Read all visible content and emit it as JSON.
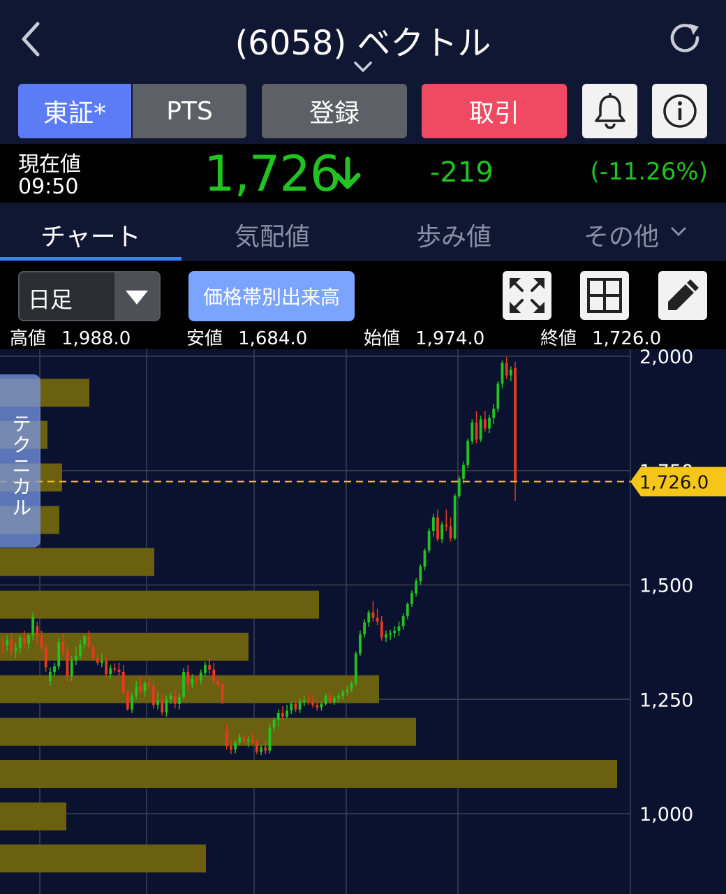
{
  "header": {
    "title": "(6058) ベクトル"
  },
  "market_tabs": {
    "tse_label": "東証*",
    "pts_label": "PTS",
    "register_label": "登録",
    "trade_label": "取引"
  },
  "price": {
    "label": "現在値",
    "time": "09:50",
    "current": "1,726",
    "change": "-219",
    "change_pct": "(-11.26%)",
    "up_color": "#21c321"
  },
  "tabs": {
    "chart": "チャート",
    "quotes": "気配値",
    "ticks": "歩み値",
    "other": "その他"
  },
  "toolbar": {
    "period": "日足",
    "volume_profile": "価格帯別出来高",
    "high_label": "高値",
    "high": "1,988.0",
    "low_label": "安値",
    "low": "1,684.0",
    "open_label": "始値",
    "open": "1,974.0",
    "close_label": "終値",
    "close": "1,726.0"
  },
  "technical_tab": "テクニカル",
  "chart_data": {
    "type": "candlestick",
    "y_ticks": [
      "2,000",
      "1,750",
      "1,500",
      "1,250",
      "1,000"
    ],
    "ylim": [
      880,
      2000
    ],
    "current_price_label": "1,726.0",
    "current_price": 1726,
    "colors": {
      "up": "#21c321",
      "down": "#e8391f",
      "profile": "#6b5f10",
      "price_line": "#f5c518"
    },
    "volume_profile": [
      {
        "price": 1920,
        "length": 128
      },
      {
        "price": 1828,
        "length": 68
      },
      {
        "price": 1735,
        "length": 89
      },
      {
        "price": 1642,
        "length": 85
      },
      {
        "price": 1550,
        "length": 221
      },
      {
        "price": 1457,
        "length": 457
      },
      {
        "price": 1365,
        "length": 356
      },
      {
        "price": 1272,
        "length": 543
      },
      {
        "price": 1179,
        "length": 596
      },
      {
        "price": 1087,
        "length": 884
      },
      {
        "price": 994,
        "length": 95
      },
      {
        "price": 902,
        "length": 295
      }
    ],
    "candles": [
      [
        1370,
        1385,
        1350,
        1368
      ],
      [
        1368,
        1390,
        1355,
        1380
      ],
      [
        1380,
        1395,
        1345,
        1355
      ],
      [
        1355,
        1375,
        1340,
        1362
      ],
      [
        1362,
        1390,
        1350,
        1385
      ],
      [
        1385,
        1400,
        1362,
        1372
      ],
      [
        1372,
        1395,
        1360,
        1390
      ],
      [
        1390,
        1440,
        1380,
        1430
      ],
      [
        1410,
        1420,
        1370,
        1390
      ],
      [
        1390,
        1400,
        1355,
        1362
      ],
      [
        1362,
        1372,
        1310,
        1320
      ],
      [
        1290,
        1320,
        1280,
        1310
      ],
      [
        1310,
        1330,
        1300,
        1322
      ],
      [
        1322,
        1385,
        1315,
        1375
      ],
      [
        1375,
        1395,
        1345,
        1355
      ],
      [
        1355,
        1370,
        1290,
        1300
      ],
      [
        1300,
        1345,
        1290,
        1335
      ],
      [
        1335,
        1365,
        1325,
        1345
      ],
      [
        1345,
        1380,
        1338,
        1370
      ],
      [
        1370,
        1392,
        1360,
        1388
      ],
      [
        1388,
        1400,
        1360,
        1365
      ],
      [
        1365,
        1372,
        1335,
        1340
      ],
      [
        1340,
        1348,
        1325,
        1330
      ],
      [
        1330,
        1350,
        1320,
        1335
      ],
      [
        1335,
        1342,
        1298,
        1305
      ],
      [
        1305,
        1325,
        1295,
        1318
      ],
      [
        1318,
        1328,
        1308,
        1315
      ],
      [
        1315,
        1330,
        1300,
        1310
      ],
      [
        1310,
        1325,
        1260,
        1265
      ],
      [
        1265,
        1270,
        1225,
        1228
      ],
      [
        1228,
        1265,
        1220,
        1258
      ],
      [
        1258,
        1290,
        1250,
        1278
      ],
      [
        1278,
        1298,
        1262,
        1268
      ],
      [
        1268,
        1290,
        1255,
        1285
      ],
      [
        1285,
        1300,
        1270,
        1278
      ],
      [
        1278,
        1292,
        1230,
        1238
      ],
      [
        1238,
        1268,
        1228,
        1248
      ],
      [
        1248,
        1262,
        1215,
        1222
      ],
      [
        1222,
        1258,
        1212,
        1250
      ],
      [
        1250,
        1265,
        1240,
        1258
      ],
      [
        1258,
        1272,
        1230,
        1240
      ],
      [
        1240,
        1262,
        1228,
        1255
      ],
      [
        1255,
        1318,
        1250,
        1310
      ],
      [
        1310,
        1325,
        1270,
        1282
      ],
      [
        1282,
        1305,
        1275,
        1295
      ],
      [
        1295,
        1300,
        1285,
        1292
      ],
      [
        1292,
        1315,
        1282,
        1308
      ],
      [
        1308,
        1332,
        1300,
        1325
      ],
      [
        1325,
        1340,
        1305,
        1315
      ],
      [
        1315,
        1330,
        1280,
        1290
      ],
      [
        1290,
        1298,
        1275,
        1282
      ],
      [
        1282,
        1285,
        1240,
        1248
      ],
      [
        1180,
        1195,
        1140,
        1148
      ],
      [
        1148,
        1160,
        1130,
        1140
      ],
      [
        1140,
        1160,
        1132,
        1155
      ],
      [
        1155,
        1175,
        1150,
        1168
      ],
      [
        1168,
        1172,
        1150,
        1158
      ],
      [
        1158,
        1170,
        1145,
        1162
      ],
      [
        1162,
        1175,
        1152,
        1158
      ],
      [
        1158,
        1162,
        1130,
        1135
      ],
      [
        1135,
        1150,
        1128,
        1145
      ],
      [
        1145,
        1160,
        1130,
        1138
      ],
      [
        1138,
        1195,
        1132,
        1188
      ],
      [
        1188,
        1210,
        1180,
        1205
      ],
      [
        1205,
        1228,
        1190,
        1220
      ],
      [
        1220,
        1235,
        1205,
        1212
      ],
      [
        1212,
        1238,
        1208,
        1225
      ],
      [
        1225,
        1245,
        1218,
        1240
      ],
      [
        1240,
        1248,
        1222,
        1228
      ],
      [
        1228,
        1252,
        1220,
        1245
      ],
      [
        1245,
        1258,
        1235,
        1248
      ],
      [
        1248,
        1262,
        1238,
        1245
      ],
      [
        1245,
        1258,
        1232,
        1238
      ],
      [
        1238,
        1250,
        1225,
        1232
      ],
      [
        1232,
        1245,
        1225,
        1240
      ],
      [
        1240,
        1262,
        1236,
        1258
      ],
      [
        1258,
        1265,
        1240,
        1244
      ],
      [
        1244,
        1258,
        1238,
        1252
      ],
      [
        1252,
        1265,
        1244,
        1258
      ],
      [
        1258,
        1272,
        1250,
        1266
      ],
      [
        1266,
        1280,
        1258,
        1272
      ],
      [
        1272,
        1290,
        1265,
        1285
      ],
      [
        1285,
        1355,
        1280,
        1350
      ],
      [
        1350,
        1400,
        1345,
        1392
      ],
      [
        1392,
        1425,
        1385,
        1418
      ],
      [
        1418,
        1445,
        1408,
        1440
      ],
      [
        1440,
        1465,
        1420,
        1428
      ],
      [
        1428,
        1448,
        1412,
        1420
      ],
      [
        1420,
        1432,
        1378,
        1385
      ],
      [
        1385,
        1400,
        1375,
        1392
      ],
      [
        1392,
        1402,
        1380,
        1395
      ],
      [
        1395,
        1410,
        1385,
        1400
      ],
      [
        1400,
        1420,
        1388,
        1410
      ],
      [
        1410,
        1438,
        1402,
        1432
      ],
      [
        1432,
        1462,
        1425,
        1458
      ],
      [
        1458,
        1488,
        1452,
        1482
      ],
      [
        1482,
        1515,
        1475,
        1508
      ],
      [
        1508,
        1545,
        1500,
        1540
      ],
      [
        1540,
        1580,
        1532,
        1575
      ],
      [
        1575,
        1625,
        1570,
        1618
      ],
      [
        1618,
        1655,
        1605,
        1648
      ],
      [
        1648,
        1665,
        1595,
        1600
      ],
      [
        1600,
        1638,
        1592,
        1632
      ],
      [
        1632,
        1665,
        1618,
        1628
      ],
      [
        1628,
        1648,
        1595,
        1602
      ],
      [
        1602,
        1700,
        1598,
        1695
      ],
      [
        1695,
        1738,
        1690,
        1732
      ],
      [
        1732,
        1770,
        1722,
        1762
      ],
      [
        1762,
        1820,
        1755,
        1815
      ],
      [
        1815,
        1862,
        1808,
        1855
      ],
      [
        1855,
        1880,
        1810,
        1818
      ],
      [
        1818,
        1870,
        1812,
        1862
      ],
      [
        1862,
        1880,
        1835,
        1842
      ],
      [
        1842,
        1872,
        1832,
        1865
      ],
      [
        1865,
        1895,
        1852,
        1885
      ],
      [
        1885,
        1945,
        1878,
        1940
      ],
      [
        1940,
        1990,
        1930,
        1985
      ],
      [
        1985,
        1998,
        1950,
        1958
      ],
      [
        1958,
        1978,
        1945,
        1970
      ],
      [
        1974,
        1988,
        1684,
        1726
      ]
    ]
  }
}
